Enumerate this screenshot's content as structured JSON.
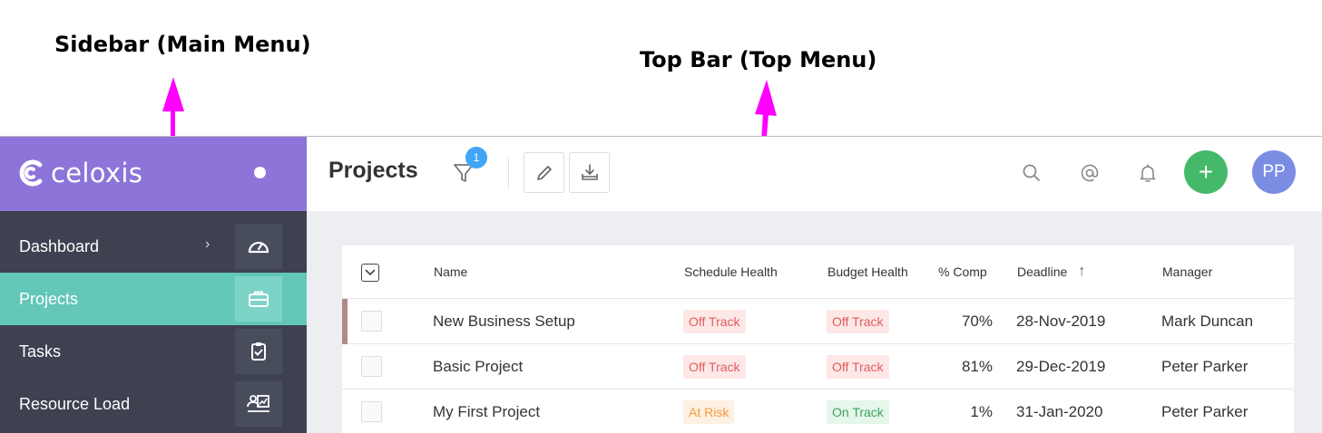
{
  "annotations": {
    "sidebar_label": "Sidebar (Main Menu)",
    "topbar_label": "Top Bar (Top Menu)",
    "arrow_color": "#ff00ff"
  },
  "app": {
    "brand": "celoxis",
    "colors": {
      "sidebar_header": "#8c74d9",
      "sidebar_bg": "#3d4150",
      "sidebar_active": "#63c7b9",
      "add_button": "#45b96a",
      "avatar": "#7b8de3",
      "badge": "#42a5f5"
    }
  },
  "sidebar": {
    "items": [
      {
        "label": "Dashboard",
        "icon": "gauge-icon",
        "has_chevron": true,
        "chevron": "›",
        "active": false
      },
      {
        "label": "Projects",
        "icon": "briefcase-icon",
        "active": true
      },
      {
        "label": "Tasks",
        "icon": "clipboard-check-icon",
        "active": false
      },
      {
        "label": "Resource Load",
        "icon": "resource-chart-icon",
        "active": false
      }
    ]
  },
  "topbar": {
    "title": "Projects",
    "filter_badge": "1",
    "icons": [
      "filter-icon",
      "pencil-icon",
      "download-icon",
      "search-icon",
      "at-icon",
      "bell-icon",
      "plus-icon"
    ],
    "add_label": "+",
    "avatar_initials": "PP"
  },
  "table": {
    "columns": {
      "name": "Name",
      "schedule": "Schedule Health",
      "budget": "Budget Health",
      "comp": "% Comp",
      "deadline": "Deadline",
      "deadline_sort": "↑",
      "manager": "Manager"
    },
    "rows": [
      {
        "name": "New Business Setup",
        "schedule": "Off Track",
        "budget": "Off Track",
        "comp": "70%",
        "deadline": "28-Nov-2019",
        "manager": "Mark Duncan"
      },
      {
        "name": "Basic Project",
        "schedule": "Off Track",
        "budget": "Off Track",
        "comp": "81%",
        "deadline": "29-Dec-2019",
        "manager": "Peter Parker"
      },
      {
        "name": "My First Project",
        "schedule": "At Risk",
        "budget": "On Track",
        "comp": "1%",
        "deadline": "31-Jan-2020",
        "manager": "Peter Parker"
      }
    ],
    "status_colors": {
      "Off Track": {
        "bg": "#fde7e7",
        "fg": "#e15c5c"
      },
      "At Risk": {
        "bg": "#fef0e2",
        "fg": "#f19a3e"
      },
      "On Track": {
        "bg": "#e5f6ea",
        "fg": "#3fa460"
      }
    }
  }
}
